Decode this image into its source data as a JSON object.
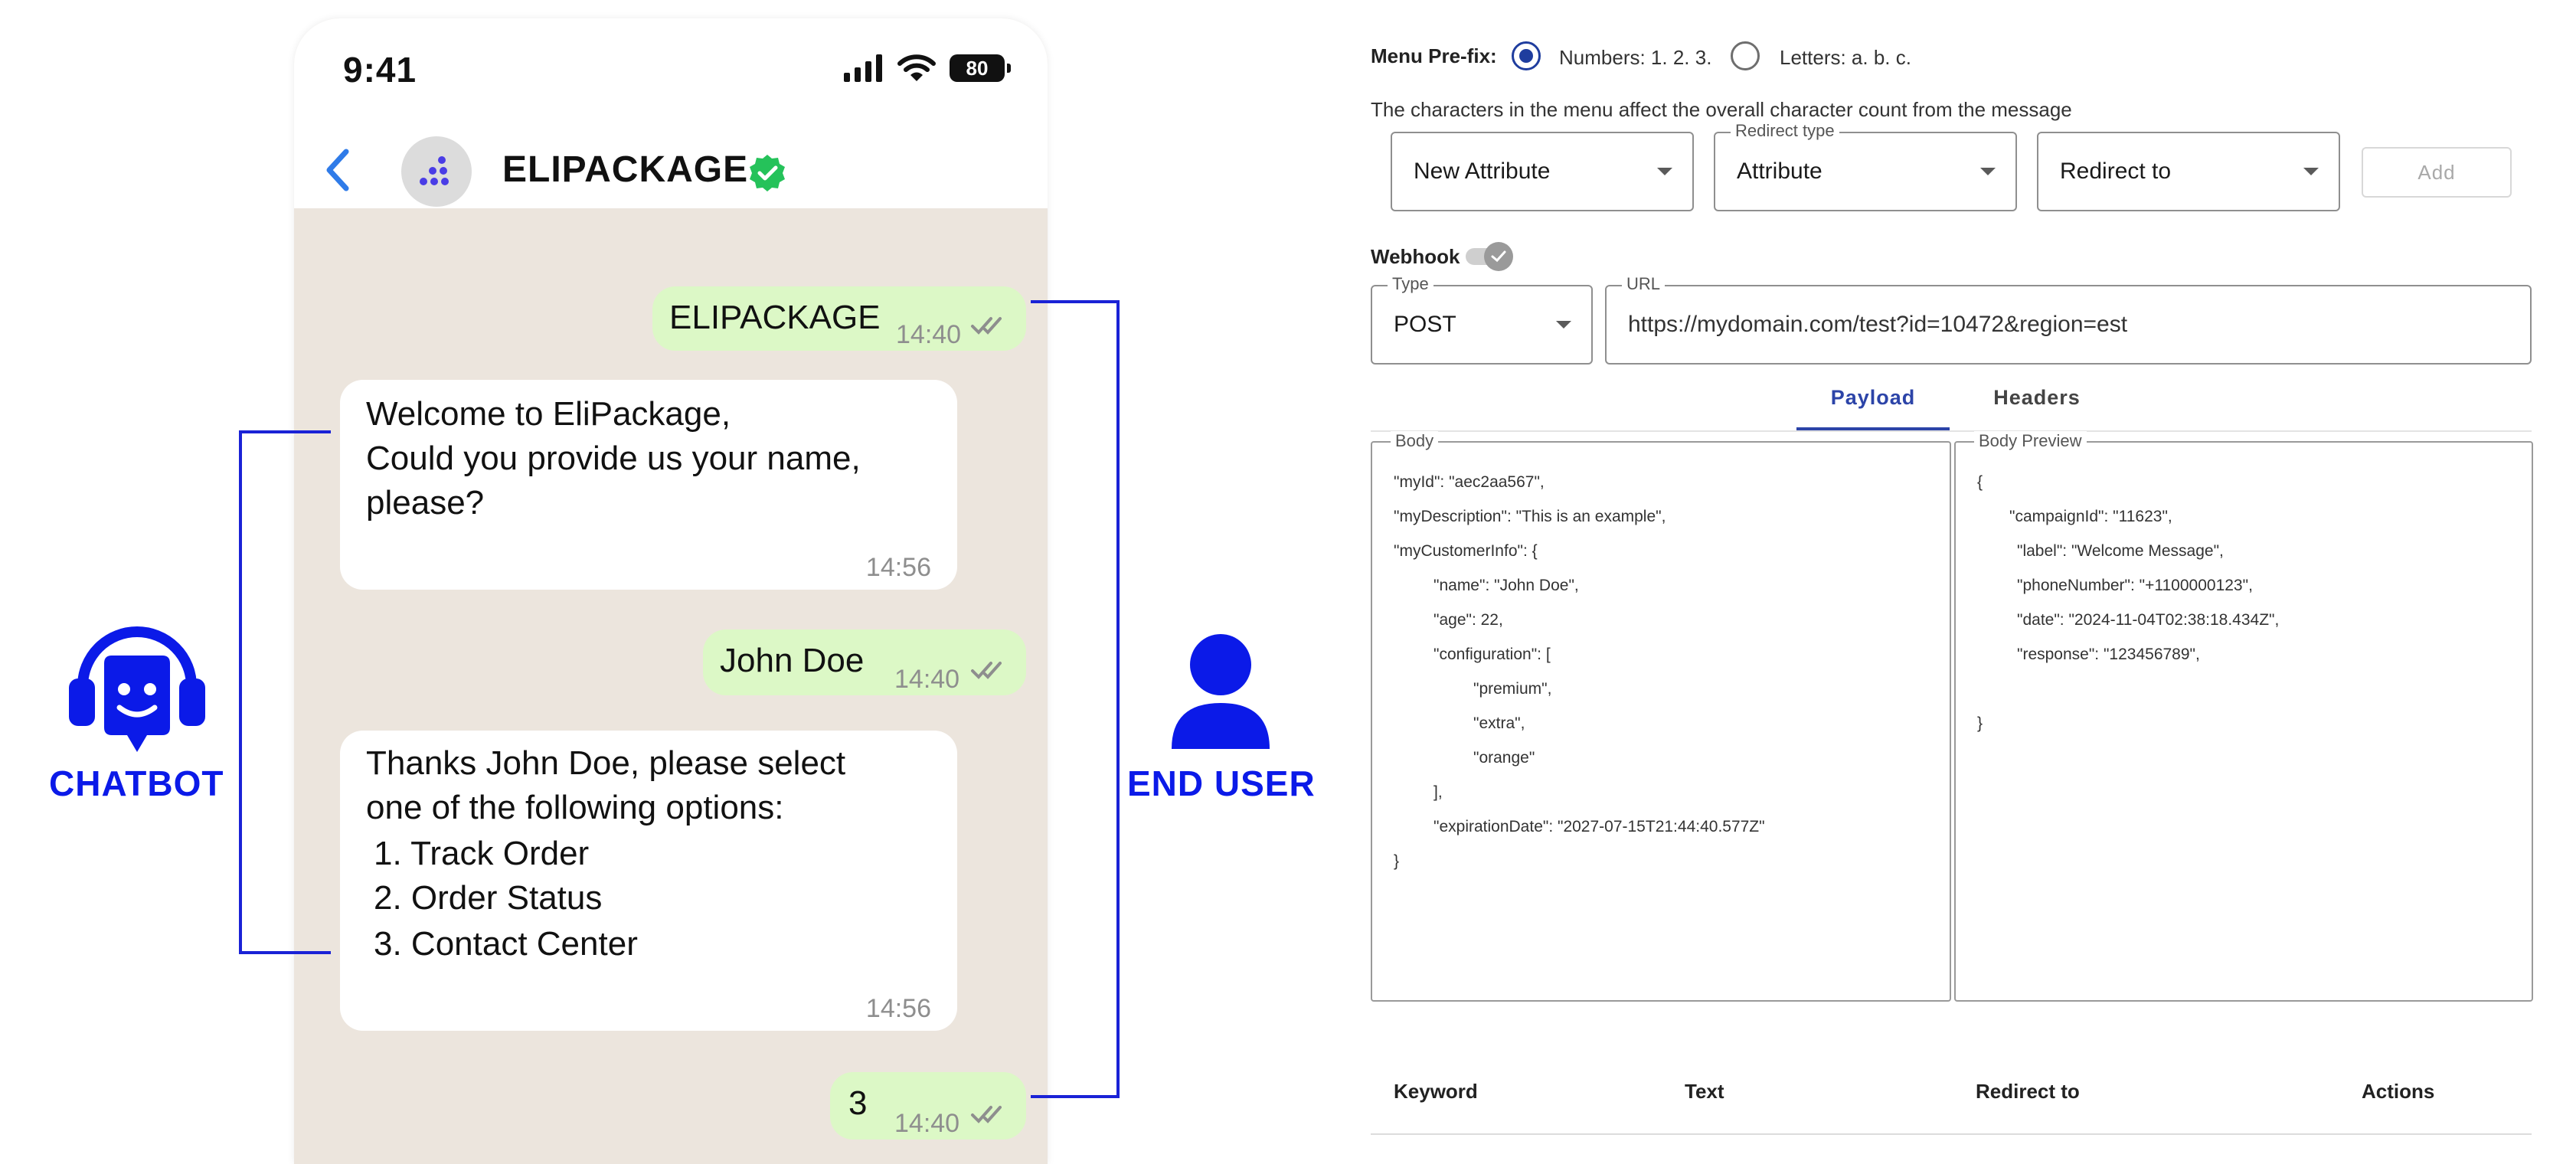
{
  "phone": {
    "status_time": "9:41",
    "battery": "80",
    "chat_name": "ELIPACKAGE",
    "messages": [
      {
        "dir": "out",
        "text": "ELIPACKAGE",
        "time": "14:40"
      },
      {
        "dir": "in",
        "lines": [
          "Welcome to EliPackage,",
          "Could you provide us your name,",
          "please?"
        ],
        "time": "14:56"
      },
      {
        "dir": "out",
        "text": "John Doe",
        "time": "14:40"
      },
      {
        "dir": "in",
        "lines": [
          "Thanks John Doe, please select",
          "one of the following options:",
          "1. Track Order",
          "2. Order Status",
          "3. Contact Center"
        ],
        "time": "14:56"
      },
      {
        "dir": "out",
        "text": "3",
        "time": "14:40"
      }
    ]
  },
  "labels": {
    "chatbot": "CHATBOT",
    "end_user": "END USER"
  },
  "panel": {
    "menu_prefix_label": "Menu Pre-fix:",
    "option_numbers": "Numbers: 1. 2. 3.",
    "option_letters": "Letters: a. b. c.",
    "menu_hint": "The characters in the menu affect the overall character count from the message",
    "attribute_select": "New Attribute",
    "redirect_type_legend": "Redirect type",
    "redirect_type_value": "Attribute",
    "redirect_to_select": "Redirect to",
    "add_button": "Add",
    "webhook_label": "Webhook",
    "type_legend": "Type",
    "type_value": "POST",
    "url_legend": "URL",
    "url_value": "https://mydomain.com/test?id=10472&region=est",
    "tabs": [
      "Payload",
      "Headers"
    ],
    "body_legend": "Body",
    "body_lines": [
      "\"myId\": \"aec2aa567\",",
      "\"myDescription\": \"This is an example\",",
      "\"myCustomerInfo\": {",
      "\"name\": \"John Doe\",",
      "\"age\": 22,",
      "\"configuration\": [",
      "\"premium\",",
      "\"extra\",",
      "\"orange\"",
      "],",
      "\"expirationDate\": \"2027-07-15T21:44:40.577Z\"",
      "}"
    ],
    "preview_legend": "Body Preview",
    "preview_lines": [
      "{",
      "\"campaignId\": \"11623\",",
      "\"label\": \"Welcome Message\",",
      "\"phoneNumber\": \"+1100000123\",",
      "\"date\": \"2024-11-04T02:38:18.434Z\",",
      "\"response\": \"123456789\",",
      "}"
    ],
    "table_headers": [
      "Keyword",
      "Text",
      "Redirect to",
      "Actions"
    ]
  }
}
